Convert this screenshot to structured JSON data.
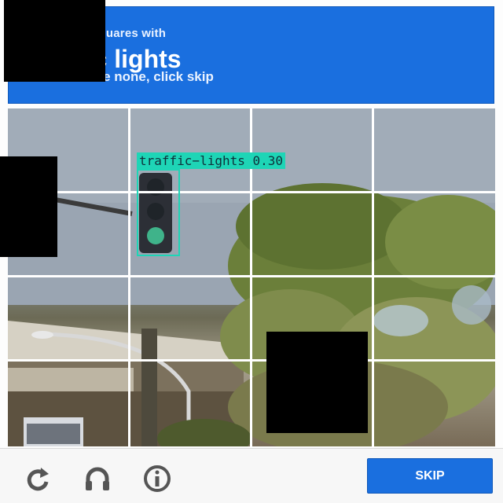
{
  "header": {
    "instruction_line": "squares with",
    "target_text": "fic lights",
    "hint_text": "are none, click skip"
  },
  "detection": {
    "label": "traffic−lights 0.30",
    "color": "#1ed5b6"
  },
  "grid": {
    "rows": 4,
    "cols": 4
  },
  "footer": {
    "icons": [
      "reload-icon",
      "audio-icon",
      "info-icon"
    ],
    "skip_label": "SKIP"
  },
  "colors": {
    "accent": "#1a6fdf",
    "detection": "#1ed5b6"
  }
}
